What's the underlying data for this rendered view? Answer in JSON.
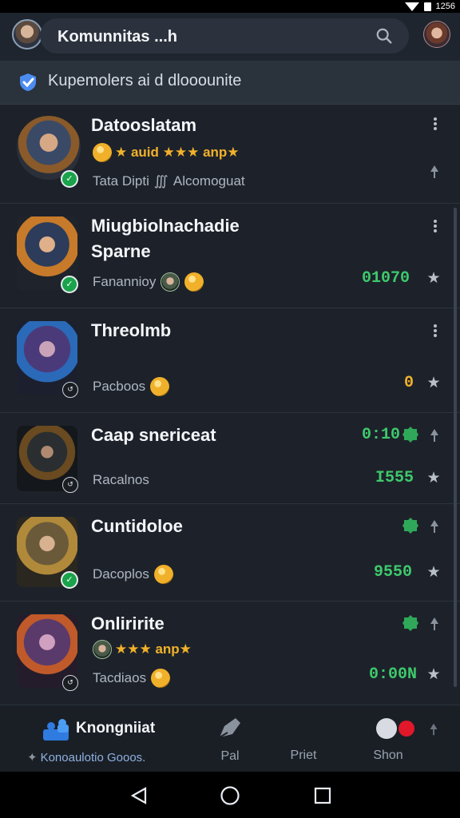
{
  "status": {
    "time": "1256"
  },
  "search": {
    "placeholder": "Komunnitas ...​h"
  },
  "banner": {
    "text": "Kupemolers ai d dlooounite"
  },
  "items": [
    {
      "title": "Datooslatam",
      "rating_text": "★ auid ★★★ anp★",
      "sub": "Tata Dipti",
      "sub2": "Alcomoguat",
      "value": ""
    },
    {
      "title": "Miugbiolnachadie Sparne",
      "sub": "Fanannioy",
      "value": "01070"
    },
    {
      "title": "Threolmb",
      "sub": "Pacboos",
      "value": "0"
    },
    {
      "title": "Caap snericeat",
      "sub": "Racalnos",
      "value_top": "0:10",
      "value": "I555"
    },
    {
      "title": "Cuntidoloe",
      "sub": "Dacoplos",
      "value": "9550"
    },
    {
      "title": "Onliririte",
      "rating_text": "★★★ anp★",
      "sub": "Tacdiaos",
      "value": "0:00N"
    }
  ],
  "nav": {
    "active_title": "Knongniiat",
    "active_sub": "Konoaulotio Gooos.",
    "items": [
      {
        "label": "Pal"
      },
      {
        "label": "Priet"
      },
      {
        "label": "Shon"
      }
    ]
  },
  "colors": {
    "accent_green": "#3ec96c",
    "accent_amber": "#f2b12a",
    "active_blue": "#2f7be0"
  },
  "icons": [
    "search-icon",
    "verified-icon",
    "more-vert-icon",
    "pin-icon",
    "star-icon",
    "back-icon",
    "home-icon",
    "recents-icon"
  ]
}
